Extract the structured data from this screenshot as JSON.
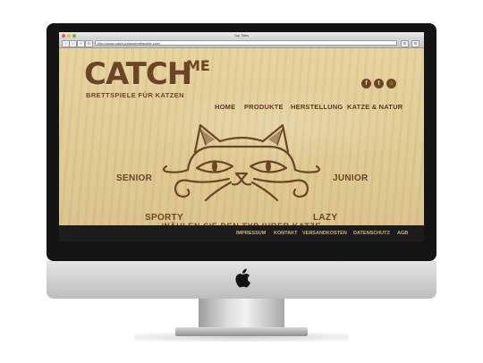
{
  "browser": {
    "window_title": "Top Sites",
    "url": "http://www.catch-katzenbrettspiele.com/"
  },
  "site": {
    "logo_main": "CATCH",
    "logo_sup": "ME",
    "tagline": "BRETTSPIELE FÜR KATZEN",
    "nav": [
      "HOME",
      "PRODUKTE",
      "HERSTELLUNG",
      "KATZE & NATUR"
    ],
    "social_icons": [
      "facebook-icon",
      "twitter-icon",
      "shop-icon"
    ],
    "cat_types": {
      "senior": "SENIOR",
      "junior": "JUNIOR",
      "sporty": "SPORTY",
      "lazy": "LAZY"
    },
    "cta": "WÄHLEN SIE DEN TYP IHRER KATZE",
    "footer_links": [
      "IMPRESSUM",
      "KONTAKT",
      "VERSANDKOSTEN",
      "DATENSCHUTZ",
      "AGB"
    ],
    "colors": {
      "wood": "#dfc98f",
      "brown": "#6b4524",
      "footer": "#1c1c1c"
    }
  }
}
